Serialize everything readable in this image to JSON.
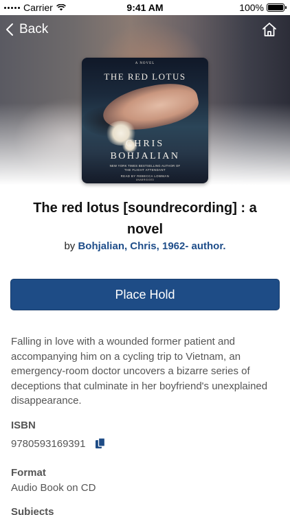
{
  "status_bar": {
    "carrier": "Carrier",
    "time": "9:41 AM",
    "battery": "100%"
  },
  "nav": {
    "back_label": "Back"
  },
  "cover": {
    "novel_tag": "A NOVEL",
    "title": "THE RED LOTUS",
    "author_first": "CHRIS",
    "author_last": "BOHJALIAN",
    "bestseller_line1": "NEW YORK TIMES BESTSELLING AUTHOR OF",
    "bestseller_line2": "THE FLIGHT ATTENDANT",
    "read_by": "READ BY REBECCA LOWMAN",
    "unabridged": "UNABRIDGED"
  },
  "item": {
    "title": "The red lotus [soundrecording] : a novel",
    "by_prefix": "by",
    "author": "Bohjalian, Chris, 1962- author.",
    "hold_button": "Place Hold",
    "description": "Falling in love with a wounded former patient and accompanying him on a cycling trip to Vietnam, an emergency-room doctor uncovers a bizarre series of deceptions that culminate in her boyfriend's unexplained disappearance.",
    "isbn_label": "ISBN",
    "isbn_value": "9780593169391",
    "format_label": "Format",
    "format_value": "Audio Book on CD",
    "subjects_label": "Subjects"
  },
  "colors": {
    "accent": "#1e4c86",
    "author_link": "#1f4e8a",
    "body_text": "#555555"
  },
  "icons": {
    "back": "chevron-left-icon",
    "home": "home-icon",
    "copy": "copy-icon",
    "wifi": "wifi-icon",
    "battery": "battery-icon"
  }
}
